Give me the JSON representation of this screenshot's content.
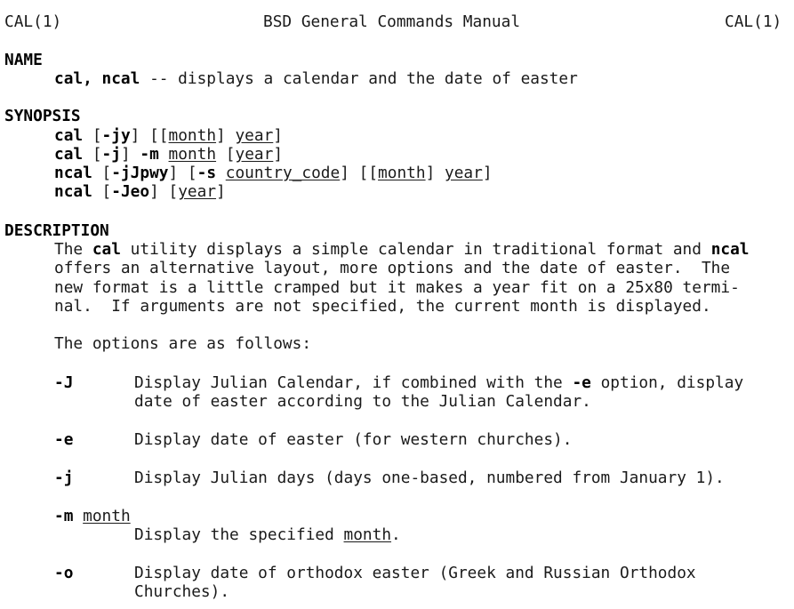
{
  "header": {
    "left": "CAL(1)",
    "center": "BSD General Commands Manual",
    "right": "CAL(1)"
  },
  "name": {
    "heading": "NAME",
    "cmd": "cal, ncal",
    "desc": " -- displays a calendar and the date of easter"
  },
  "synopsis": {
    "heading": "SYNOPSIS",
    "l1": {
      "cmd": "cal",
      "o1": " [",
      "flags": "-jy",
      "o2": "] [[",
      "a1": "month",
      "o3": "] ",
      "a2": "year",
      "o4": "]"
    },
    "l2": {
      "cmd": "cal",
      "o1": " [",
      "flags": "-j",
      "o2": "] ",
      "m": "-m",
      "sp": " ",
      "a1": "month",
      "o3": " [",
      "a2": "year",
      "o4": "]"
    },
    "l3": {
      "cmd": "ncal",
      "o1": " [",
      "flags": "-jJpwy",
      "o2": "] [",
      "s": "-s",
      "sp": " ",
      "a1": "country_code",
      "o3": "] [[",
      "a2": "month",
      "o4": "] ",
      "a3": "year",
      "o5": "]"
    },
    "l4": {
      "cmd": "ncal",
      "o1": " [",
      "flags": "-Jeo",
      "o2": "] [",
      "a1": "year",
      "o3": "]"
    }
  },
  "description": {
    "heading": "DESCRIPTION",
    "p1": {
      "t1": "The ",
      "b1": "cal",
      "t2": " utility displays a simple calendar in traditional format and ",
      "b2": "ncal"
    },
    "p2": "offers an alternative layout, more options and the date of easter.  The",
    "p3": "new format is a little cramped but it makes a year fit on a 25x80 termi-",
    "p4": "nal.  If arguments are not specified, the current month is displayed.",
    "options_intro": "The options are as follows:"
  },
  "options": {
    "J": {
      "flag": "-J",
      "t1": "Display Julian Calendar, if combined with the ",
      "b": "-e",
      "t2": " option, display",
      "t3": "date of easter according to the Julian Calendar."
    },
    "e": {
      "flag": "-e",
      "text": "Display date of easter (for western churches)."
    },
    "j": {
      "flag": "-j",
      "text": "Display Julian days (days one-based, numbered from January 1)."
    },
    "m": {
      "flag": "-m",
      "arg": "month",
      "t1": "Display the specified ",
      "u": "month",
      "t2": "."
    },
    "o": {
      "flag": "-o",
      "t1": "Display date of orthodox easter (Greek and Russian Orthodox",
      "t2": "Churches)."
    }
  }
}
